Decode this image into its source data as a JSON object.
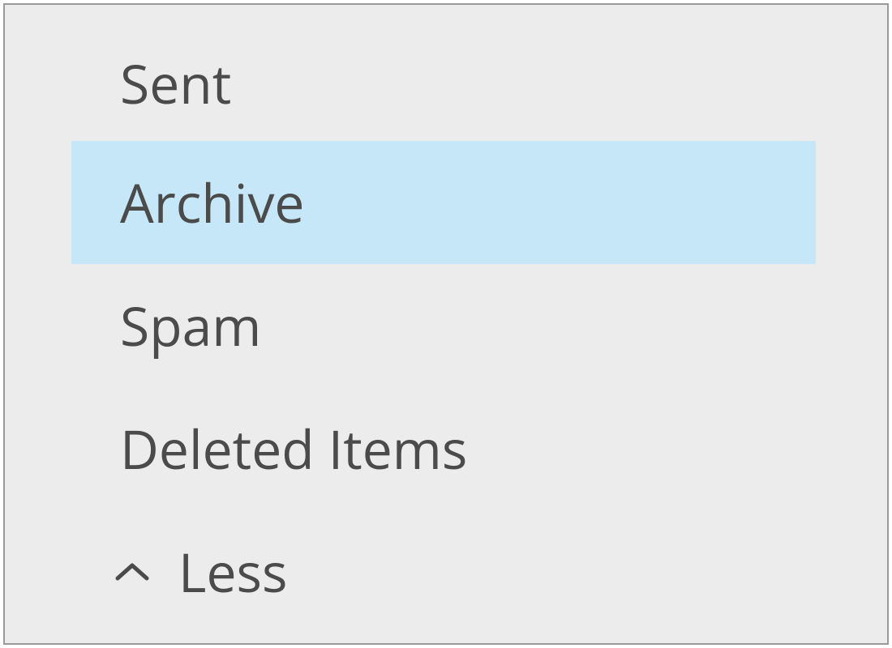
{
  "sidebar": {
    "folders": [
      {
        "label": "Sent",
        "active": false
      },
      {
        "label": "Archive",
        "active": true
      },
      {
        "label": "Spam",
        "active": false
      },
      {
        "label": "Deleted Items",
        "active": false
      }
    ],
    "collapse": {
      "label": "Less",
      "icon": "chevron-up-icon"
    }
  },
  "colors": {
    "panel_bg": "#ececec",
    "panel_border": "#9a9a9a",
    "text": "#4b4b4b",
    "active_bg": "#c5e7f7"
  }
}
